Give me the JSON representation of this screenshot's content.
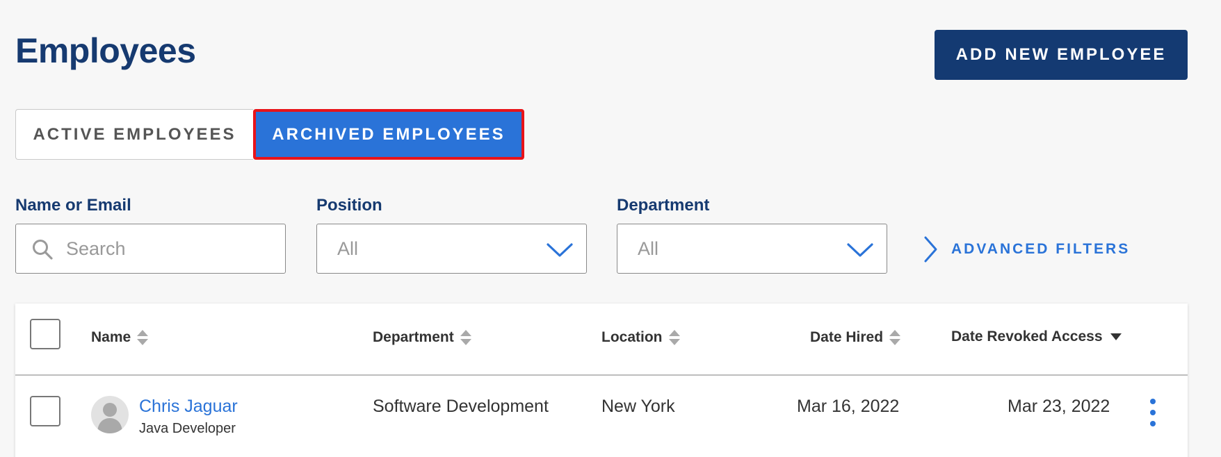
{
  "page": {
    "title": "Employees",
    "add_button_label": "ADD NEW EMPLOYEE"
  },
  "tabs": [
    {
      "label": "ACTIVE EMPLOYEES",
      "selected": false
    },
    {
      "label": "ARCHIVED EMPLOYEES",
      "selected": true
    }
  ],
  "filters": {
    "name_label": "Name or Email",
    "search_placeholder": "Search",
    "search_value": "",
    "position_label": "Position",
    "position_value": "All",
    "department_label": "Department",
    "department_value": "All",
    "advanced_label": "ADVANCED FILTERS"
  },
  "table": {
    "columns": [
      {
        "label": "Name",
        "sort": "both"
      },
      {
        "label": "Department",
        "sort": "both"
      },
      {
        "label": "Location",
        "sort": "both"
      },
      {
        "label": "Date Hired",
        "sort": "both"
      },
      {
        "label": "Date Revoked Access",
        "sort": "descending"
      }
    ],
    "rows": [
      {
        "name": "Chris Jaguar",
        "role": "Java Developer",
        "department": "Software Development",
        "location": "New York",
        "date_hired": "Mar 16, 2022",
        "date_revoked": "Mar 23, 2022"
      }
    ]
  },
  "icons": {
    "search": "search-icon",
    "dropdown": "chevron-down-icon",
    "advanced": "chevron-right-icon",
    "sort": "sort-icon",
    "sort_desc": "sort-down-icon",
    "row_menu": "more-vertical-icon",
    "avatar": "avatar-placeholder-icon"
  },
  "colors": {
    "title": "#163a70",
    "primary_button": "#143a72",
    "accent": "#2a73d8",
    "highlight_border": "#e8141a",
    "background": "#f7f7f7"
  }
}
